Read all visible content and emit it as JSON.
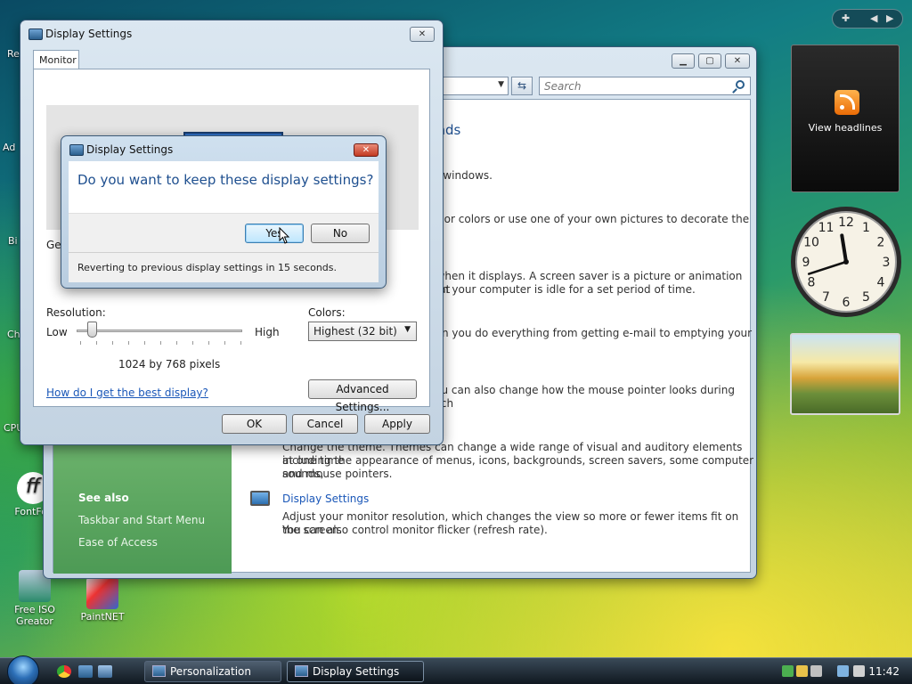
{
  "desktop": {
    "edge_labels": [
      "Re",
      "Ad",
      "Bi",
      "Ch",
      "CPU"
    ],
    "icons": [
      {
        "label": "FontFor",
        "id": "fontforge"
      },
      {
        "label": "Free ISO Greator",
        "id": "free-iso"
      },
      {
        "label": "PaintNET",
        "id": "paintnet"
      }
    ]
  },
  "personalization": {
    "search_placeholder": "Search",
    "heading": "unds",
    "lines": [
      "ur windows.",
      "ds or colors or use one of your own pictures to decorate the",
      "t when it displays. A screen saver is a picture or animation that",
      "hen your computer is idle for a set period of time.",
      "hen you do everything from getting e-mail to emptying your",
      "you can also change how the mouse pointer looks during such",
      "Change the theme. Themes can change a wide range of visual and auditory elements at one time",
      "including the appearance of menus, icons, backgrounds, screen savers, some computer sounds,",
      "and mouse pointers."
    ],
    "display_settings_link": "Display Settings",
    "display_settings_desc_1": "Adjust your monitor resolution, which changes the view so more or fewer items fit on the screen.",
    "display_settings_desc_2": "You can also control monitor flicker (refresh rate).",
    "see_also": {
      "heading": "See also",
      "links": [
        "Taskbar and Start Menu",
        "Ease of Access"
      ]
    }
  },
  "display_settings": {
    "title": "Display Settings",
    "tab": "Monitor",
    "partial_label": "Ger",
    "resolution_label": "Resolution:",
    "low": "Low",
    "high": "High",
    "resolution_value": "1024 by 768 pixels",
    "colors_label": "Colors:",
    "colors_value": "Highest (32 bit)",
    "help_link": "How do I get the best display?",
    "advanced_button": "Advanced Settings...",
    "ok": "OK",
    "cancel": "Cancel",
    "apply": "Apply"
  },
  "confirm": {
    "title": "Display Settings",
    "question": "Do you want to keep these display settings?",
    "yes": "Yes",
    "no": "No",
    "countdown": "Reverting to previous display settings in 15 seconds."
  },
  "sidebar": {
    "feed_label": "View headlines"
  },
  "clock_gadget": {
    "hours": [
      12,
      1,
      2,
      3,
      4,
      5,
      6,
      7,
      8,
      9,
      10,
      11
    ]
  },
  "taskbar": {
    "tasks": [
      "Personalization",
      "Display Settings"
    ],
    "time": "11:42"
  }
}
